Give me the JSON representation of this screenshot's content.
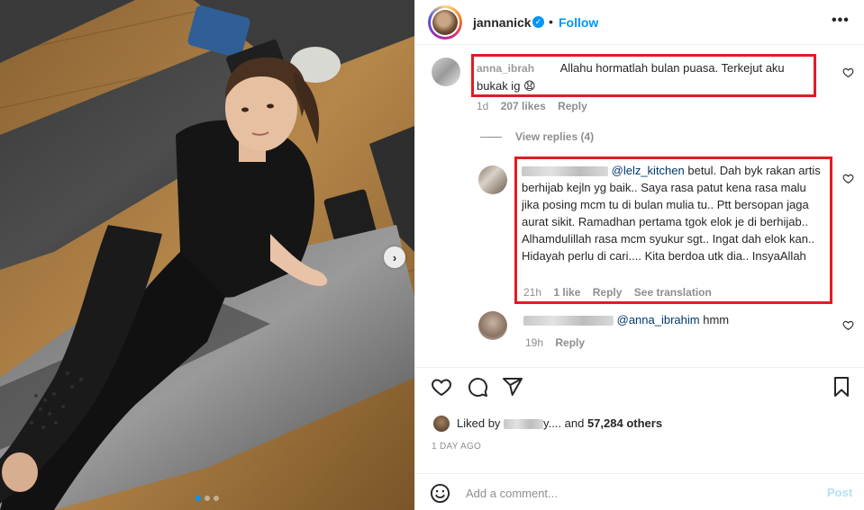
{
  "post": {
    "username": "jannanick",
    "verified_icon": "verified-badge-icon",
    "separator": "•",
    "follow_label": "Follow",
    "more_icon": "more-options-icon",
    "carousel": {
      "total": 3,
      "active_index": 0
    }
  },
  "comments": [
    {
      "username": "anna_ibrah",
      "text": "Allahu hormatlah bulan puasa. Terkejut aku bukak ig 😧",
      "age": "1d",
      "likes": "207 likes",
      "reply_label": "Reply"
    }
  ],
  "view_replies": "View replies (4)",
  "replies": [
    {
      "mention": "@lelz_kitchen",
      "text": " betul. Dah byk rakan artis berhijab kejln yg baik.. Saya rasa patut kena rasa malu jika posing mcm tu di bulan mulia tu.. Ptt bersopan jaga aurat sikit. Ramadhan pertama tgok elok je di berhijab.. Alhamdulillah rasa mcm syukur sgt.. Ingat dah elok kan.. Hidayah perlu di cari.... Kita berdoa utk dia.. InsyaAllah",
      "age": "21h",
      "likes": "1 like",
      "reply_label": "Reply",
      "translation_label": "See translation"
    },
    {
      "mention": "@anna_ibrahim",
      "text": " hmm",
      "age": "19h",
      "reply_label": "Reply"
    }
  ],
  "actions": {
    "like_icon": "heart-icon",
    "comment_icon": "comment-icon",
    "share_icon": "share-icon",
    "save_icon": "bookmark-icon"
  },
  "likes_summary": {
    "prefix": "Liked by ",
    "suffix": "y.... and ",
    "count": "57,284 others"
  },
  "date": "1 DAY AGO",
  "comment_box": {
    "emoji_icon": "emoji-icon",
    "placeholder": "Add a comment...",
    "post_label": "Post"
  },
  "colors": {
    "accent": "#0095f6",
    "highlight_box": "#e31b23",
    "muted_text": "#8e8e8e"
  }
}
